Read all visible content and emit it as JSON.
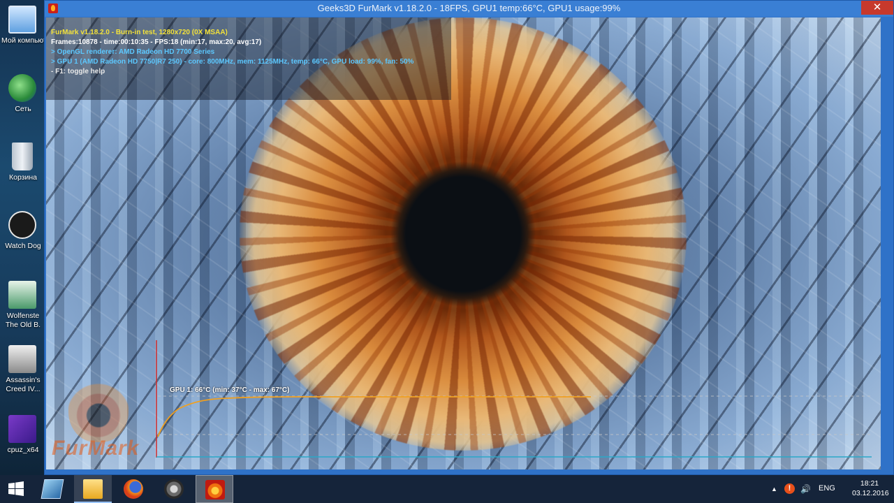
{
  "desktop": {
    "icons": [
      {
        "label": "Мой компьюте"
      },
      {
        "label": "Сеть"
      },
      {
        "label": "Корзина"
      },
      {
        "label": "Watch Dog"
      },
      {
        "label": "Wolfenste The Old B."
      },
      {
        "label": "Assassin's Creed IV..."
      },
      {
        "label": "cpuz_x64"
      }
    ]
  },
  "window": {
    "title": "Geeks3D FurMark v1.18.2.0 - 18FPS, GPU1 temp:66°C, GPU1 usage:99%",
    "close_label": "✕"
  },
  "overlay": {
    "line1": "FurMark v1.18.2.0 - Burn-in test, 1280x720 (0X MSAA)",
    "line2": "Frames:10878 - time:00:10:35 - FPS:18 (min:17, max:20, avg:17)",
    "line3": "> OpenGL renderer: AMD Radeon HD 7700 Series",
    "line4": "> GPU 1 (AMD Radeon HD 7750|R7 250) - core: 800MHz, mem: 1125MHz, temp: 66°C, GPU load: 99%, fan: 50%",
    "line5": "- F1: toggle help"
  },
  "graph": {
    "label": "GPU 1: 66°C (min: 37°C - max: 67°C)",
    "line_color": "#f0a020"
  },
  "watermark": "FurMark",
  "taskbar": {
    "lang": "ENG",
    "time": "18:21",
    "date": "03.12.2016"
  }
}
